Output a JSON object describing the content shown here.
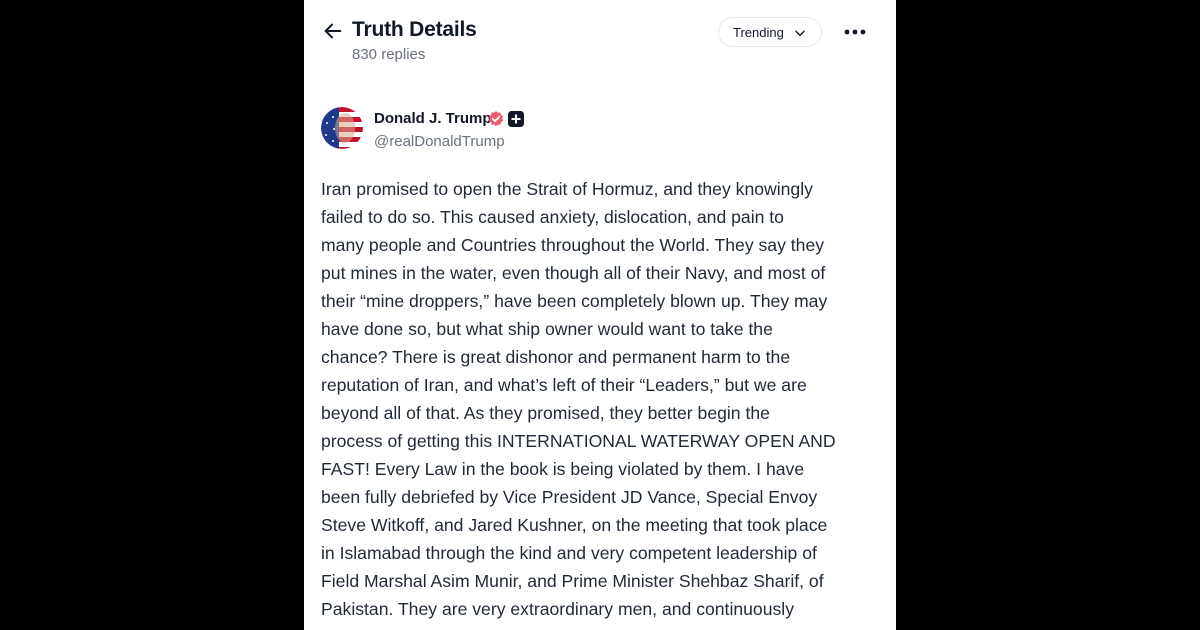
{
  "header": {
    "title": "Truth Details",
    "replies": "830 replies",
    "sort_label": "Trending"
  },
  "author": {
    "name": "Donald J. Trump",
    "handle": "@realDonaldTrump"
  },
  "icons": {
    "back": "arrow-left-icon",
    "sort": "chevron-down-icon",
    "more": "more-horizontal-icon",
    "verified": "verified-badge-icon",
    "plus": "plus-badge-icon"
  },
  "colors": {
    "verified_badge": "#f05a6e",
    "text_primary": "#111827",
    "text_secondary": "#6b7280"
  },
  "post": {
    "lines": [
      "Iran promised to open the Strait of Hormuz, and they knowingly",
      "failed to do so. This caused anxiety, dislocation, and pain to",
      "many people and Countries throughout the World. They say they",
      "put mines in the water, even though all of their Navy, and most of",
      "their “mine droppers,” have been completely blown up. They may",
      "have done so, but what ship owner would want to take the",
      "chance? There is great dishonor and permanent harm to the",
      "reputation of Iran, and what’s left of their “Leaders,” but we are",
      "beyond all of that. As they promised, they better begin the",
      "process of getting this INTERNATIONAL WATERWAY OPEN AND",
      "FAST! Every Law in the book is being violated by them. I have",
      "been fully debriefed by Vice President JD Vance, Special Envoy",
      "Steve Witkoff, and Jared Kushner, on the meeting that took place",
      "in Islamabad through the kind and very competent leadership of",
      "Field Marshal Asim Munir, and Prime Minister Shehbaz Sharif, of",
      "Pakistan. They are very extraordinary men, and continuously"
    ]
  }
}
